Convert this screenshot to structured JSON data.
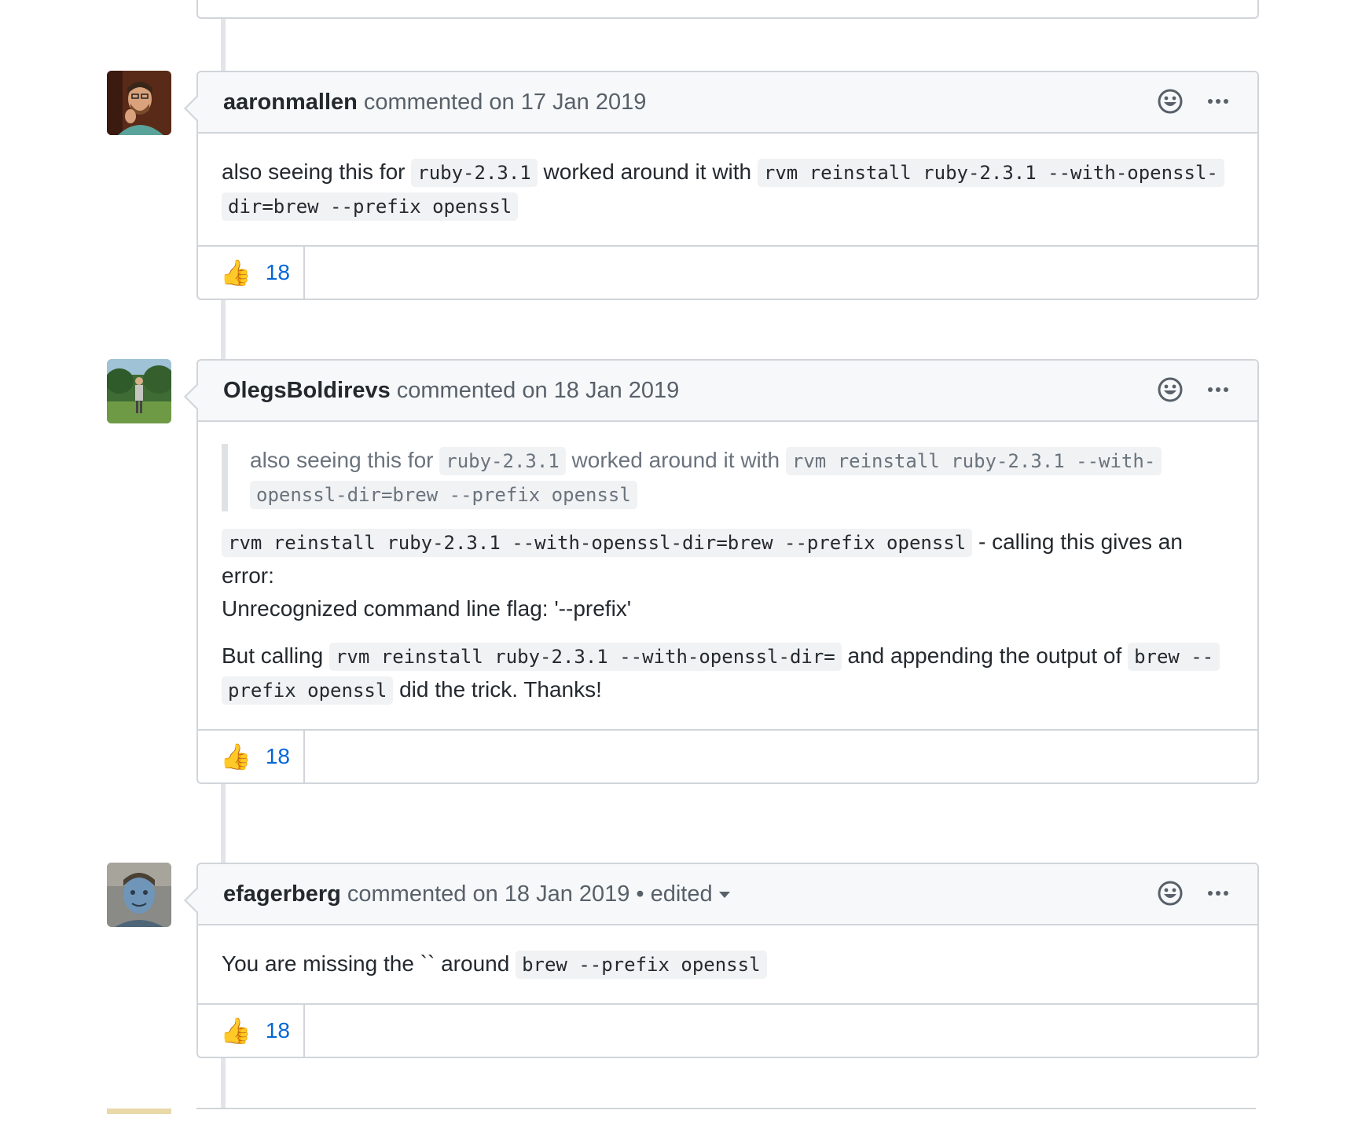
{
  "comments": [
    {
      "author": "aaronmallen",
      "meta": "commented on 17 Jan 2019",
      "body": {
        "p1_text1": "also seeing this for",
        "p1_code1": "ruby-2.3.1",
        "p1_text2": "worked around it with",
        "p1_code2a": "rvm reinstall ruby-2.3.1 --with-openssl-",
        "p1_code2b": "dir=brew --prefix openssl"
      },
      "reaction": {
        "emoji": "👍",
        "count": "18"
      }
    },
    {
      "author": "OlegsBoldirevs",
      "meta": "commented on 18 Jan 2019",
      "body": {
        "quote_text1": "also seeing this for",
        "quote_code1": "ruby-2.3.1",
        "quote_text2": "worked around it with",
        "quote_code2a": "rvm reinstall ruby-2.3.1 --with-",
        "quote_code2b": "openssl-dir=brew --prefix openssl",
        "p1_code": "rvm reinstall ruby-2.3.1 --with-openssl-dir=brew --prefix openssl",
        "p1_text": "- calling this gives an error:",
        "p1_line2": "Unrecognized command line flag: '--prefix'",
        "p2_text1": "But calling",
        "p2_code1": "rvm reinstall ruby-2.3.1 --with-openssl-dir=",
        "p2_text2": "and appending the output of",
        "p2_code2a": "brew --",
        "p2_code2b": "prefix openssl",
        "p2_text3": "did the trick. Thanks!"
      },
      "reaction": {
        "emoji": "👍",
        "count": "18"
      }
    },
    {
      "author": "efagerberg",
      "meta": "commented on 18 Jan 2019",
      "edited_sep": "•",
      "edited": "edited",
      "body": {
        "p1_text1": "You are missing the `` around",
        "p1_code": "brew --prefix openssl"
      },
      "reaction": {
        "emoji": "👍",
        "count": "18"
      }
    }
  ],
  "icons": {
    "add_reaction": "smiley-icon",
    "more": "kebab-horizontal-icon"
  },
  "colors": {
    "link": "#0366d6",
    "border": "#d1d5da",
    "header_bg": "#f6f8fa"
  }
}
